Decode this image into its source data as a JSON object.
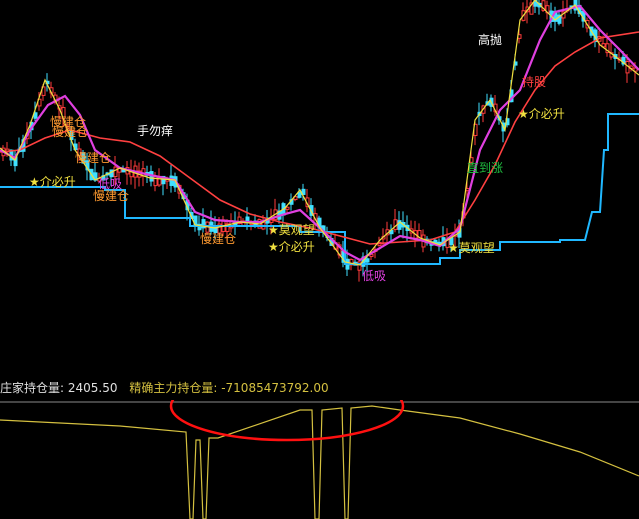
{
  "chart_data": [
    {
      "type": "candlestick",
      "panel": "main",
      "colors": {
        "up_candle": "#ff3b3b",
        "down_candle": "#40e0ff",
        "ma_red": "#ff4040",
        "ma_magenta": "#e040e0",
        "ma_yellow": "#f0e040",
        "support_line": "#20b8ff"
      },
      "annotations": [
        {
          "text": "慢建仓",
          "color": "#ff9a30"
        },
        {
          "text": "慢建仓",
          "color": "#ff9a30"
        },
        {
          "text": "手勿痒",
          "color": "#ffffff"
        },
        {
          "text": "慢建仓",
          "color": "#ff9a30"
        },
        {
          "text": "★介必升",
          "color": "#f0e040"
        },
        {
          "text": "低吸",
          "color": "#e040e0"
        },
        {
          "text": "慢建仓",
          "color": "#ff9a30"
        },
        {
          "text": "慢建仓",
          "color": "#ff9a30"
        },
        {
          "text": "★莫观望",
          "color": "#f0e040"
        },
        {
          "text": "★介必升",
          "color": "#f0e040"
        },
        {
          "text": "低吸",
          "color": "#e040e0"
        },
        {
          "text": "★莫观望",
          "color": "#f0e040"
        },
        {
          "text": "高抛",
          "color": "#ffffff"
        },
        {
          "text": "持股",
          "color": "#ff4040"
        },
        {
          "text": "★介必升",
          "color": "#f0e040"
        },
        {
          "text": "直到涨",
          "color": "#20c040"
        }
      ]
    },
    {
      "type": "line",
      "panel": "indicator",
      "colors": {
        "line": "#d4c040",
        "divider": "#8a8a8a",
        "highlight_ellipse": "#ff1010"
      }
    }
  ],
  "info_bar": {
    "label1": "庄家持仓量:",
    "value1": "2405.50",
    "label2": "精确主力持仓量:",
    "value2": "-71085473792.00"
  }
}
